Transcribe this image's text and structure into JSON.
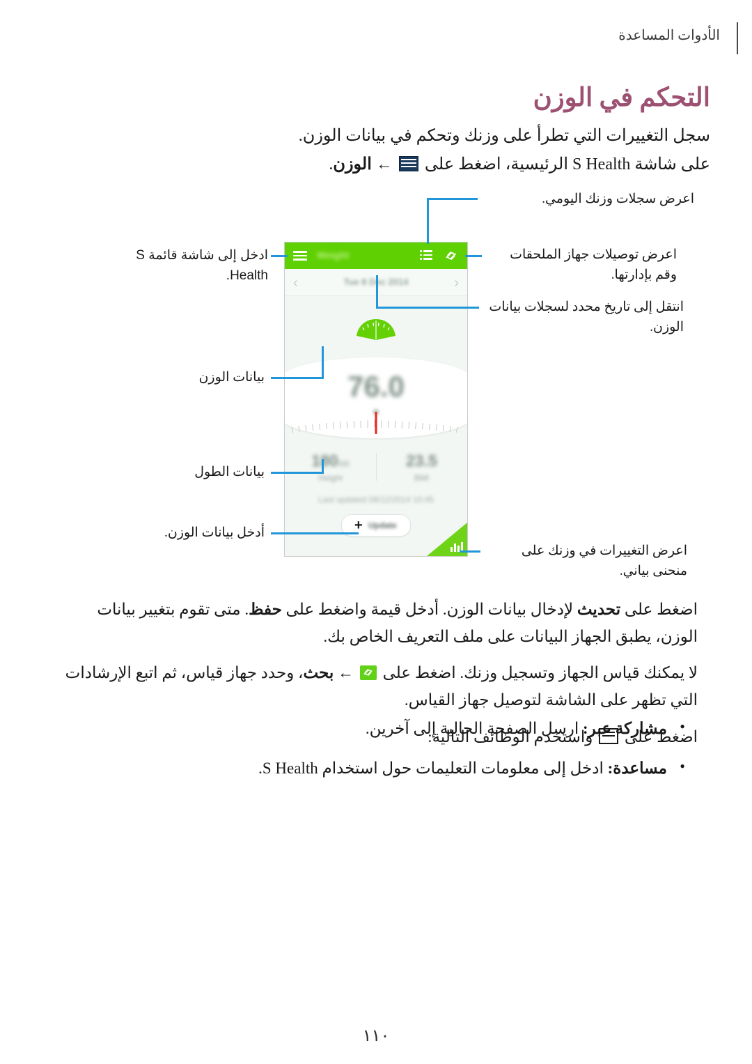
{
  "header": {
    "section_title": "الأدوات المساعدة"
  },
  "doc": {
    "title": "التحكم في الوزن",
    "intro_line_1": "سجل التغييرات التي تطرأ على وزنك وتحكم في بيانات الوزن.",
    "intro_line_2_part_a": "على شاشة",
    "intro_line_2_brand": "S Health",
    "intro_line_2_part_b": "الرئيسية، اضغط على",
    "intro_line_2_arrow": "←",
    "intro_line_2_bold": "الوزن",
    "intro_line_2_period": "."
  },
  "phone": {
    "appbar": {
      "title": "Weight",
      "hamburger_icon": "hamburger-icon",
      "list_icon": "list-icon",
      "link_icon": "link-icon"
    },
    "datebar": {
      "prev": "‹",
      "next": "›",
      "date": "Tue 8 Dec 2014"
    },
    "gauge": {
      "weight_value": "76.0",
      "scale_icon": "weighing-scale-icon"
    },
    "stats": {
      "height_value": "180",
      "height_unit": "cm",
      "height_label": "Height",
      "bmi_value": "23.5",
      "bmi_label": "BMI"
    },
    "last_updated": "Last updated 08/12/2014 10:45",
    "update_button": {
      "plus": "+",
      "label": "Update"
    },
    "corner_chart_icon": "bar-chart-icon"
  },
  "callouts": {
    "left": [
      {
        "id": "menu-screen",
        "text": "ادخل إلى شاشة قائمة S Health."
      },
      {
        "id": "weight-data",
        "text": "بيانات الوزن"
      },
      {
        "id": "height-data",
        "text": "بيانات الطول"
      },
      {
        "id": "enter-weight-data",
        "text": "أدخل بيانات الوزن."
      }
    ],
    "right": [
      {
        "id": "daily-records",
        "text": "اعرض سجلات وزنك اليومي."
      },
      {
        "id": "accessory-connections",
        "text": "اعرض توصيلات جهاز الملحقات وقم بإدارتها."
      },
      {
        "id": "jump-to-date",
        "text": "انتقل إلى تاريخ محدد لسجلات بيانات الوزن."
      },
      {
        "id": "weight-graph",
        "text": "اعرض التغييرات في وزنك على منحنى بياني."
      }
    ]
  },
  "body": {
    "para1_a": "اضغط على",
    "para1_bold1": "تحديث",
    "para1_b": "لإدخال بيانات الوزن. أدخل قيمة واضغط على",
    "para1_bold2": "حفظ",
    "para1_c": ". متى تقوم بتغيير بيانات الوزن، يطبق الجهاز البيانات على ملف التعريف الخاص بك.",
    "para2_a": "لا يمكنك قياس الجهاز وتسجيل وزنك. اضغط على",
    "para2_arrow": "←",
    "para2_bold": "بحث",
    "para2_b": "، وحدد جهاز قياس، ثم اتبع الإرشادات التي تظهر على الشاشة لتوصيل جهاز القياس.",
    "para3_a": "اضغط على",
    "para3_b": "واستخدم الوظائف التالية:"
  },
  "bullets": [
    {
      "label": "مشاركة عبر:",
      "text": "ارسل الصفحة الحالية إلى آخرين."
    },
    {
      "label": "مساعدة:",
      "text": "ادخل إلى معلومات التعليمات حول استخدام S Health."
    }
  ],
  "page_number": "١١٠",
  "colors": {
    "title": "#9d5172",
    "appbar_green": "#5fd002",
    "lead_line_blue": "#2196d9",
    "needle_red": "#e8261c",
    "corner_green": "#6fd418"
  }
}
